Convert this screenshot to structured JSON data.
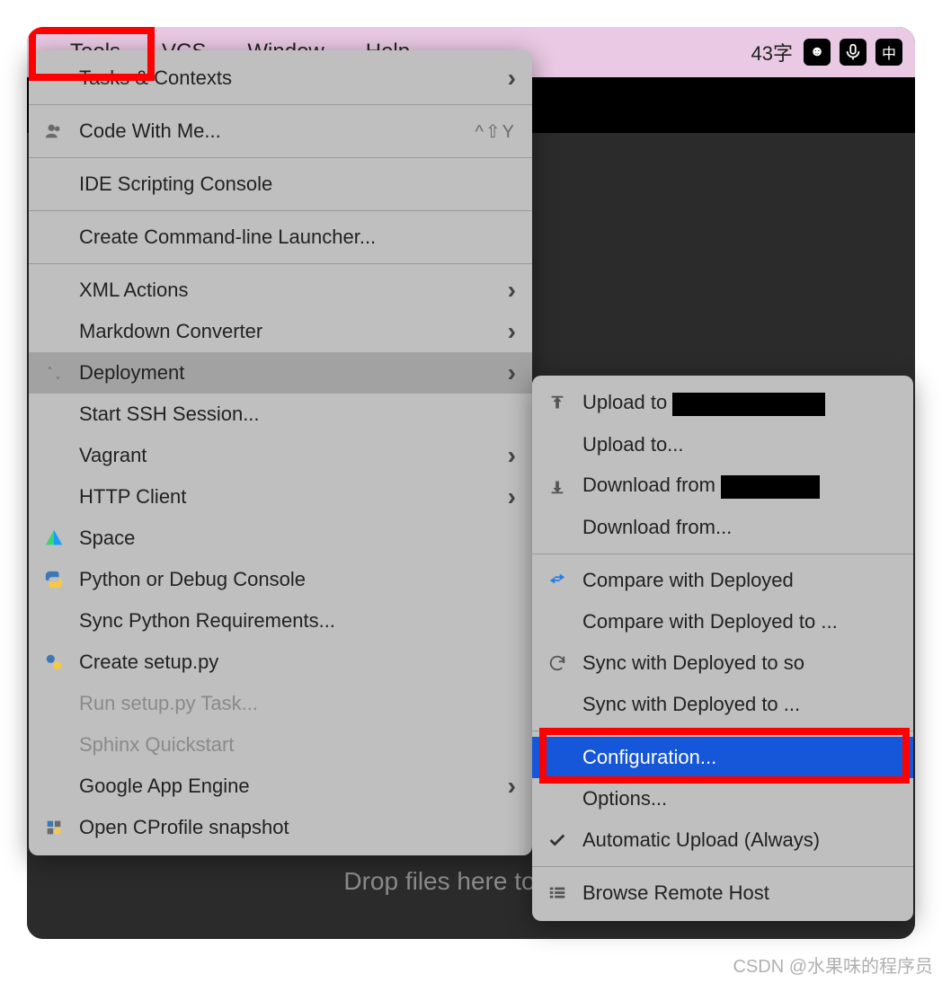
{
  "menubar": {
    "items": [
      "Tools",
      "VCS",
      "Window",
      "Help"
    ],
    "ime": "43字"
  },
  "tools_menu": {
    "items": [
      {
        "label": "Tasks & Contexts",
        "submenu": true
      },
      {
        "sep": true
      },
      {
        "label": "Code With Me...",
        "icon": "people-icon",
        "shortcut": "^⇧Y"
      },
      {
        "sep": true
      },
      {
        "label": "IDE Scripting Console"
      },
      {
        "sep": true
      },
      {
        "label": "Create Command-line Launcher..."
      },
      {
        "sep": true
      },
      {
        "label": "XML Actions",
        "submenu": true
      },
      {
        "label": "Markdown Converter",
        "submenu": true
      },
      {
        "label": "Deployment",
        "icon": "updown-icon",
        "submenu": true,
        "hovered": true
      },
      {
        "label": "Start SSH Session..."
      },
      {
        "label": "Vagrant",
        "submenu": true
      },
      {
        "label": "HTTP Client",
        "submenu": true
      },
      {
        "label": "Space",
        "icon": "space-icon"
      },
      {
        "label": "Python or Debug Console",
        "icon": "python-icon"
      },
      {
        "label": "Sync Python Requirements..."
      },
      {
        "label": "Create setup.py",
        "icon": "python-small-icon"
      },
      {
        "label": "Run setup.py Task...",
        "disabled": true
      },
      {
        "label": "Sphinx Quickstart",
        "disabled": true
      },
      {
        "label": "Google App Engine",
        "submenu": true
      },
      {
        "label": "Open CProfile snapshot",
        "icon": "profile-icon"
      }
    ]
  },
  "deploy_menu": {
    "items": [
      {
        "label": "Upload to ",
        "icon": "upload-icon",
        "redacted": 170
      },
      {
        "label": "Upload to..."
      },
      {
        "label": "Download from ",
        "icon": "download-icon",
        "redacted": 110
      },
      {
        "label": "Download from..."
      },
      {
        "sep": true
      },
      {
        "label": "Compare with Deployed ",
        "icon": "compare-icon",
        "clip": true
      },
      {
        "label": "Compare with Deployed to ..."
      },
      {
        "label": "Sync with Deployed to so",
        "icon": "sync-icon",
        "clip": true
      },
      {
        "label": "Sync with Deployed to ..."
      },
      {
        "sep": true
      },
      {
        "label": "Configuration...",
        "selected": true
      },
      {
        "label": "Options..."
      },
      {
        "label": "Automatic Upload (Always)",
        "icon": "check-icon"
      },
      {
        "sep": true
      },
      {
        "label": "Browse Remote Host",
        "icon": "list-icon"
      }
    ]
  },
  "editor": {
    "drop_hint": "Drop files here to open"
  },
  "watermark": "CSDN @水果味的程序员"
}
